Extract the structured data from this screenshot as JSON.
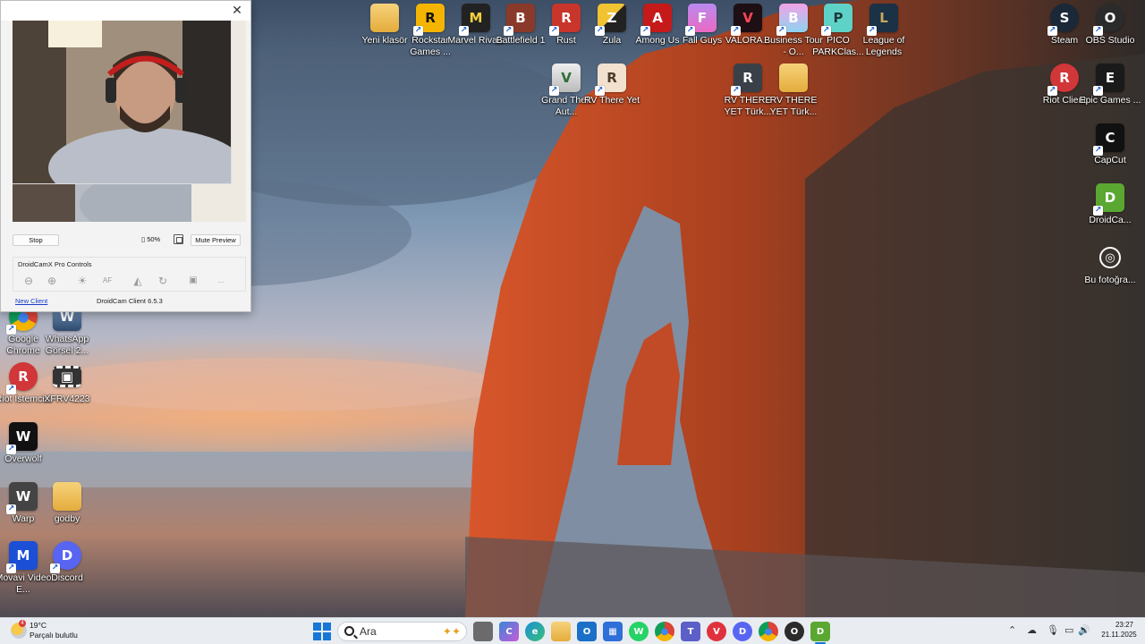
{
  "desktop": {
    "top_icons": [
      {
        "label": "Yeni klasör",
        "glyph": "",
        "color": "#e8b84a",
        "icon": "folder-icon"
      },
      {
        "label": "Rockstar Games ...",
        "glyph": "R",
        "color": "#f5b400",
        "icon": "rockstar-icon"
      },
      {
        "label": "Marvel Rivals",
        "glyph": "M",
        "color": "#222222",
        "icon": "marvel-rivals-icon"
      },
      {
        "label": "Battlefield 1",
        "glyph": "B",
        "color": "#8a3a2a",
        "icon": "battlefield-icon"
      },
      {
        "label": "Rust",
        "glyph": "R",
        "color": "#c8352a",
        "icon": "rust-icon"
      },
      {
        "label": "Zula",
        "glyph": "Z",
        "color": "#2a2a2a",
        "icon": "zula-icon"
      },
      {
        "label": "Among Us",
        "glyph": "A",
        "color": "#c61a1a",
        "icon": "among-us-icon"
      },
      {
        "label": "Fall Guys",
        "glyph": "F",
        "color": "#7a5ad8",
        "icon": "fall-guys-icon"
      },
      {
        "label": "VALORA...",
        "glyph": "V",
        "color": "#1d0f14",
        "icon": "valorant-icon"
      },
      {
        "label": "Business Tour - O...",
        "glyph": "B",
        "color": "#d46fd0",
        "icon": "business-tour-icon"
      },
      {
        "label": "PICO PARKClas...",
        "glyph": "P",
        "color": "#5fd2c8",
        "icon": "pico-park-icon"
      },
      {
        "label": "League of Legends",
        "glyph": "L",
        "color": "#1a3146",
        "icon": "league-of-legends-icon"
      }
    ],
    "second_row": [
      {
        "label": "Grand Theft Aut...",
        "glyph": "V",
        "color": "#2f6e3a",
        "icon": "gta-icon"
      },
      {
        "label": "RV There Yet",
        "glyph": "R",
        "color": "#e6c8a8",
        "icon": "rv-there-yet-icon"
      },
      {
        "label": "RV THERE YET Türk...",
        "glyph": "R",
        "color": "#3a4048",
        "icon": "rv-there-yet-tr-icon"
      },
      {
        "label": "RV THERE YET Türk...",
        "glyph": "",
        "color": "#e8b84a",
        "icon": "folder-icon"
      }
    ],
    "right_icons": [
      {
        "label": "Steam",
        "glyph": "S",
        "color": "#1b2838",
        "icon": "steam-icon"
      },
      {
        "label": "OBS Studio",
        "glyph": "O",
        "color": "#2b2b2b",
        "icon": "obs-icon"
      },
      {
        "label": "Riot Client",
        "glyph": "R",
        "color": "#d13639",
        "icon": "riot-client-icon"
      },
      {
        "label": "Epic Games ...",
        "glyph": "E",
        "color": "#1a1a1a",
        "icon": "epic-games-icon"
      },
      {
        "label": "CapCut",
        "glyph": "C",
        "color": "#111111",
        "icon": "capcut-icon"
      },
      {
        "label": "DroidCa...",
        "glyph": "D",
        "color": "#5aa832",
        "icon": "droidcam-icon"
      },
      {
        "label": "Bu fotoğra...",
        "glyph": "◎",
        "color": "#3a3a3a",
        "icon": "this-pc-icon"
      }
    ],
    "left_icons": [
      {
        "label": "Google Chrome",
        "glyph": "●",
        "color": "#dd4b39",
        "icon": "chrome-icon"
      },
      {
        "label": "WhatsApp Görsel 2...",
        "glyph": "W",
        "color": "#3b5e8c",
        "icon": "image-file-icon"
      },
      {
        "label": "Riot İstemcisi",
        "glyph": "R",
        "color": "#d13639",
        "icon": "riot-client-icon"
      },
      {
        "label": "XFRV4223",
        "glyph": "▣",
        "color": "#333333",
        "icon": "video-file-icon"
      },
      {
        "label": "Overwolf",
        "glyph": "W",
        "color": "#111111",
        "icon": "overwolf-icon"
      },
      {
        "label": "Warp",
        "glyph": "W",
        "color": "#444444",
        "icon": "warp-icon"
      },
      {
        "label": "godby",
        "glyph": "",
        "color": "#e8b84a",
        "icon": "folder-icon"
      },
      {
        "label": "Movavi Video E...",
        "glyph": "M",
        "color": "#1a4fd6",
        "icon": "movavi-icon"
      },
      {
        "label": "Discord",
        "glyph": "D",
        "color": "#5865f2",
        "icon": "discord-icon"
      }
    ]
  },
  "droidcam": {
    "stop_label": "Stop",
    "battery_text": "50%",
    "mute_label": "Mute Preview",
    "pro_title": "DroidCamX Pro Controls",
    "af_label": "AF",
    "more_label": "...",
    "new_client_label": "New Client",
    "version_label": "DroidCam Client 6.5.3"
  },
  "taskbar": {
    "weather_temp": "19°C",
    "weather_desc": "Parçalı bulutlu",
    "search_placeholder": "Ara",
    "time": "23:27",
    "date": "21.11.2025",
    "apps": [
      {
        "glyph": "",
        "color": "#6b6b6b",
        "icon": "task-view-icon"
      },
      {
        "glyph": "C",
        "color": "#3a86d8",
        "icon": "copilot-icon"
      },
      {
        "glyph": "e",
        "color": "#1a8fd6",
        "icon": "edge-icon"
      },
      {
        "glyph": "",
        "color": "#e8b84a",
        "icon": "file-explorer-icon"
      },
      {
        "glyph": "O",
        "color": "#1a6fc8",
        "icon": "outlook-icon"
      },
      {
        "glyph": "▦",
        "color": "#2f6fd8",
        "icon": "store-icon"
      },
      {
        "glyph": "W",
        "color": "#25d366",
        "icon": "whatsapp-icon"
      },
      {
        "glyph": "●",
        "color": "#dd4b39",
        "icon": "chrome-icon"
      },
      {
        "glyph": "T",
        "color": "#5b5fc7",
        "icon": "teams-icon"
      },
      {
        "glyph": "V",
        "color": "#e0323e",
        "icon": "valorant-tray-icon"
      },
      {
        "glyph": "D",
        "color": "#5865f2",
        "icon": "discord-icon"
      },
      {
        "glyph": "●",
        "color": "#dd4b39",
        "icon": "chrome-profile-icon"
      },
      {
        "glyph": "O",
        "color": "#2b2b2b",
        "icon": "obs-icon"
      },
      {
        "glyph": "D",
        "color": "#5aa832",
        "icon": "droidcam-icon"
      }
    ]
  }
}
